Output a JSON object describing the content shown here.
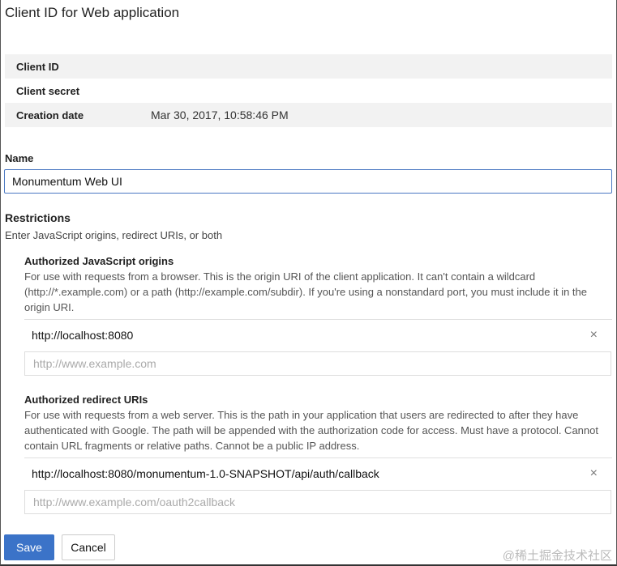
{
  "title": "Client ID for Web application",
  "info": {
    "client_id_label": "Client ID",
    "client_secret_label": "Client secret",
    "creation_date_label": "Creation date",
    "creation_date": "Mar 30, 2017, 10:58:46 PM"
  },
  "name": {
    "label": "Name",
    "value": "Monumentum Web UI"
  },
  "restrictions": {
    "label": "Restrictions",
    "hint": "Enter JavaScript origins, redirect URIs, or both"
  },
  "origins": {
    "label": "Authorized JavaScript origins",
    "help": "For use with requests from a browser. This is the origin URI of the client application. It can't contain a wildcard (http://*.example.com) or a path (http://example.com/subdir). If you're using a nonstandard port, you must include it in the origin URI.",
    "items": [
      "http://localhost:8080"
    ],
    "placeholder": "http://www.example.com"
  },
  "redirects": {
    "label": "Authorized redirect URIs",
    "help": "For use with requests from a web server. This is the path in your application that users are redirected to after they have authenticated with Google. The path will be appended with the authorization code for access. Must have a protocol. Cannot contain URL fragments or relative paths. Cannot be a public IP address.",
    "items": [
      "http://localhost:8080/monumentum-1.0-SNAPSHOT/api/auth/callback"
    ],
    "placeholder": "http://www.example.com/oauth2callback"
  },
  "buttons": {
    "save": "Save",
    "cancel": "Cancel"
  },
  "remove_icon": "×",
  "watermark": "@稀土掘金技术社区"
}
